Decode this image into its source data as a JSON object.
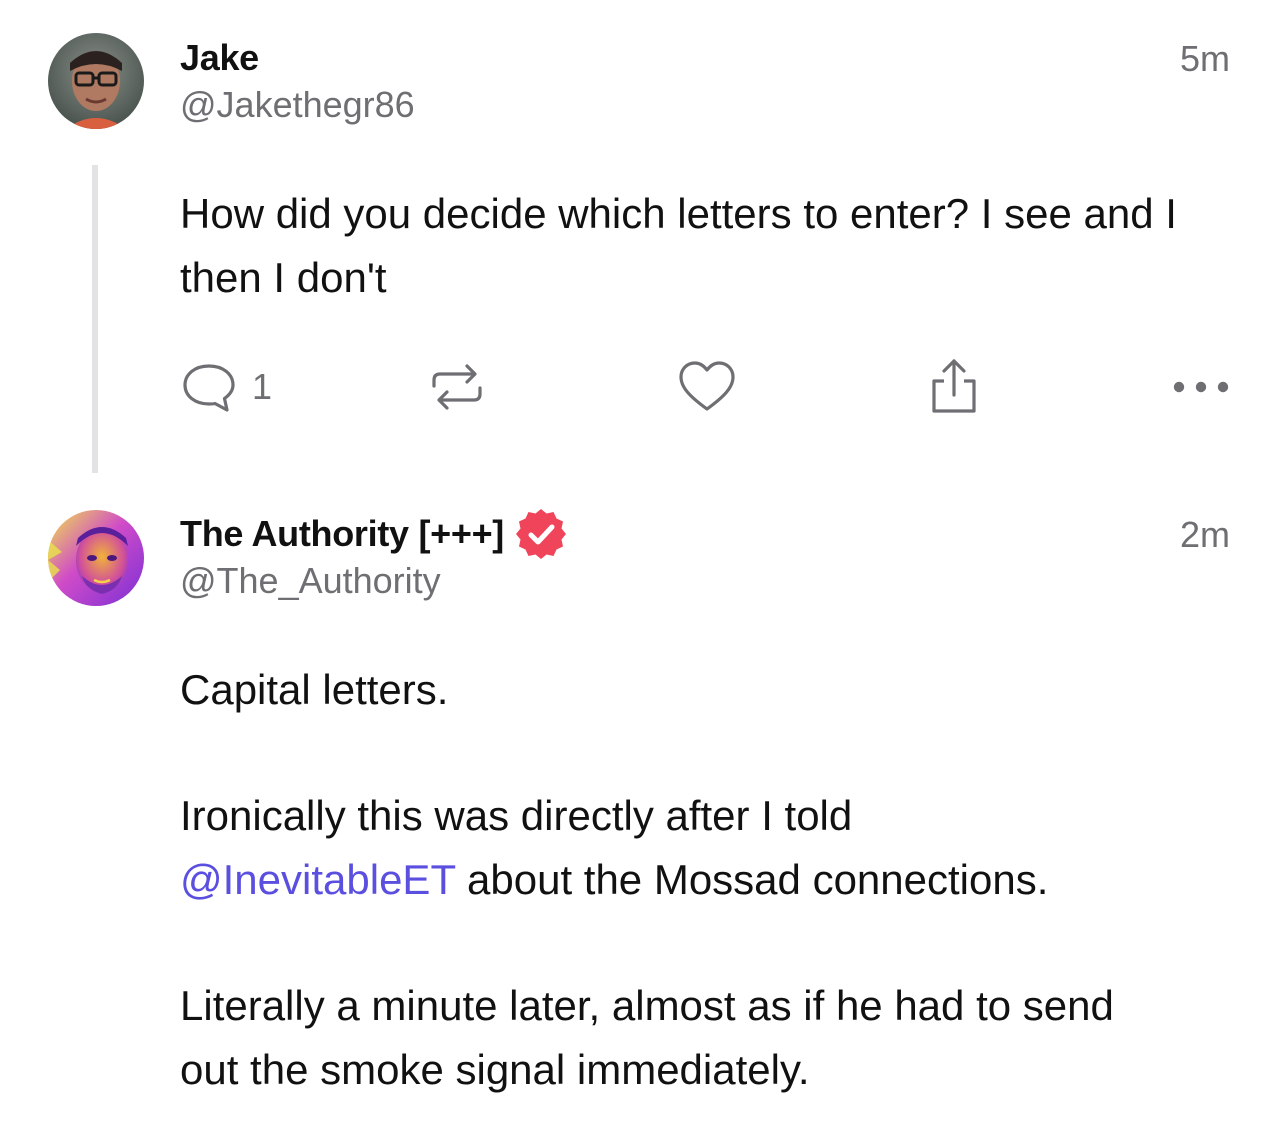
{
  "posts": [
    {
      "display_name": "Jake",
      "handle": "@Jakethegr86",
      "time": "5m",
      "body_lines": [
        "How did you decide which letters to enter? I see and I then I don't"
      ],
      "actions": {
        "reply_count": "1"
      }
    },
    {
      "display_name": "The Authority [+++]",
      "handle": "@The_Authority",
      "time": "2m",
      "verified": true,
      "body": {
        "p1": "Capital letters.",
        "p2_before": "Ironically this was directly after I told",
        "p2_mention": "@InevitableET",
        "p2_after": " about the Mossad connections.",
        "p3": "Literally a minute later, almost as if he had to send out the smoke signal immediately."
      }
    }
  ],
  "icons": {
    "reply": "speech-bubble-icon",
    "repost": "repost-arrows-icon",
    "like": "heart-icon",
    "share": "share-upload-icon",
    "more": "ellipsis-icon",
    "verified": "verified-badge-icon"
  },
  "colors": {
    "mention": "#5b4fe0",
    "verified_badge": "#f0445a",
    "secondary_text": "#6e6e73",
    "thread_line": "#e3e3e6"
  }
}
